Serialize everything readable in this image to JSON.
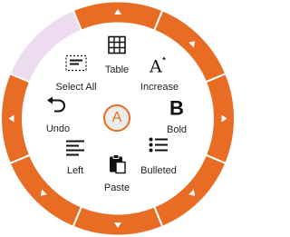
{
  "menu": {
    "center_label": "A",
    "items": [
      {
        "id": "table",
        "label": "Table",
        "icon": "table-icon"
      },
      {
        "id": "increase",
        "label": "Increase",
        "icon": "increase-font-icon"
      },
      {
        "id": "bold",
        "label": "Bold",
        "icon": "bold-icon"
      },
      {
        "id": "bulleted",
        "label": "Bulleted",
        "icon": "bulleted-list-icon"
      },
      {
        "id": "paste",
        "label": "Paste",
        "icon": "paste-icon"
      },
      {
        "id": "left",
        "label": "Left",
        "icon": "align-left-icon"
      },
      {
        "id": "undo",
        "label": "Undo",
        "icon": "undo-icon"
      },
      {
        "id": "select_all",
        "label": "Select All",
        "icon": "select-all-icon"
      }
    ]
  },
  "colors": {
    "accent": "#e96c25",
    "highlight": "#eddcef",
    "text": "#222222",
    "center_bg": "#ececec"
  },
  "ring": {
    "segments": [
      {
        "direction": "up",
        "state": "active"
      },
      {
        "direction": "up-right",
        "state": "active"
      },
      {
        "direction": "right",
        "state": "active"
      },
      {
        "direction": "down-right",
        "state": "active"
      },
      {
        "direction": "down",
        "state": "active"
      },
      {
        "direction": "down-left",
        "state": "active"
      },
      {
        "direction": "left",
        "state": "active"
      },
      {
        "direction": "up-left",
        "state": "highlight"
      }
    ]
  }
}
